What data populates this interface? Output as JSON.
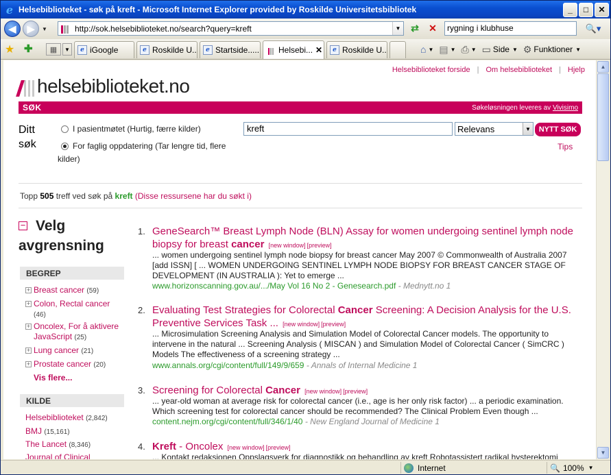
{
  "window": {
    "title": "Helsebiblioteket - søk på kreft - Microsoft Internet Explorer provided by Roskilde Universitetsbibliotek",
    "min": "_",
    "max": "□",
    "close": "✕"
  },
  "nav": {
    "address": "http://sok.helsebiblioteket.no/search?query=kreft",
    "search_value": "rygning i klubhuse"
  },
  "tabs": [
    {
      "label": "iGoogle"
    },
    {
      "label": "Roskilde U..."
    },
    {
      "label": "Startside....."
    },
    {
      "label": "Helsebi..."
    },
    {
      "label": "Roskilde U..."
    }
  ],
  "tools": {
    "page": "Side",
    "functions": "Funktioner"
  },
  "site": {
    "links": [
      "Helsebiblioteket forside",
      "Om helsebiblioteket",
      "Hjelp"
    ],
    "logo_text": "helsebiblioteket.no",
    "band_left": "SØK",
    "band_right_prefix": "Søkeløsningen leveres av ",
    "band_right_link": "Vivisimo",
    "ditt_label_1": "Ditt",
    "ditt_label_2": "søk",
    "radio1": "I pasientmøtet (Hurtig, færre kilder)",
    "radio2a": "For faglig oppdatering (Tar lengre tid, flere",
    "radio2b": "kilder)",
    "query": "kreft",
    "sort": "Relevans",
    "button": "NYTT SØK",
    "tips": "Tips"
  },
  "summary": {
    "pre": "Topp ",
    "count": "505",
    "mid": " treff ved søk på ",
    "query": "kreft",
    "note": " (Disse ressursene har du søkt i)"
  },
  "sidebar": {
    "title1": "Velg",
    "title2": "avgrensning",
    "begrep": "BEGREP",
    "facets": [
      {
        "label": "Breast cancer",
        "count": "(59)"
      },
      {
        "label": "Colon, Rectal cancer",
        "count": "(46)"
      },
      {
        "label": "Oncolex, For å aktivere JavaScript",
        "count": "(25)"
      },
      {
        "label": "Lung cancer",
        "count": "(21)"
      },
      {
        "label": "Prostate cancer",
        "count": "(20)"
      }
    ],
    "more": "Vis flere...",
    "kilde": "KILDE",
    "sources": [
      {
        "label": "Helsebiblioteket",
        "count": "(2,842)"
      },
      {
        "label": "BMJ",
        "count": "(15,161)"
      },
      {
        "label": "The Lancet",
        "count": "(8,346)"
      },
      {
        "label": "Journal of Clinical",
        "count": ""
      }
    ]
  },
  "results": [
    {
      "num": "1.",
      "title_a": "GeneSearch™ Breast Lymph Node (BLN) Assay for women undergoing sentinel lymph node biopsy for breast ",
      "title_b": "cancer",
      "title_c": "",
      "snippet": "... women undergoing sentinel lymph node biopsy for breast cancer May 2007 © Commonwealth of Australia 2007 [add ISSN] [ ... WOMEN UNDERGOING SENTINEL LYMPH NODE BIOPSY FOR BREAST CANCER STAGE OF DEVELOPMENT (IN AUSTRALIA ): Yet to emerge ...",
      "url": "www.horizonscanning.gov.au/.../May Vol 16 No 2 - Genesearch.pdf",
      "source": " - Mednytt.no 1"
    },
    {
      "num": "2.",
      "title_a": "Evaluating Test Strategies for Colorectal ",
      "title_b": "Cancer",
      "title_c": " Screening: A Decision Analysis for the U.S. Preventive Services Task ...",
      "snippet": "... Microsimulation Screening Analysis and Simulation Model of Colorectal Cancer models. The opportunity to intervene in the natural ... Screening Analysis ( MISCAN ) and Simulation Model of Colorectal Cancer ( SimCRC ) Models The effectiveness of a screening strategy ...",
      "url": "www.annals.org/cgi/content/full/149/9/659",
      "source": " - Annals of Internal Medicine 1"
    },
    {
      "num": "3.",
      "title_a": "Screening for Colorectal ",
      "title_b": "Cancer",
      "title_c": "",
      "snippet": "... year-old woman at average risk for colorectal cancer (i.e., age is her only risk factor) ... a periodic examination. Which screening test for colorectal cancer should be recommended? The Clinical Problem Even though ...",
      "url": "content.nejm.org/cgi/content/full/346/1/40",
      "source": " - New England Journal of Medicine 1"
    },
    {
      "num": "4.",
      "title_a": "",
      "title_b": "Kreft",
      "title_c": " - Oncolex",
      "snippet": "... Kontakt redaksjonen Oppslagsverk for diagnostikk og behandling av kreft Robotassistert radikal hysterektomi",
      "url": "",
      "source": ""
    }
  ],
  "result_links": {
    "new_window": "[new window]",
    "preview": "[preview]"
  },
  "status": {
    "zone": "Internet",
    "zoom": "100%"
  }
}
